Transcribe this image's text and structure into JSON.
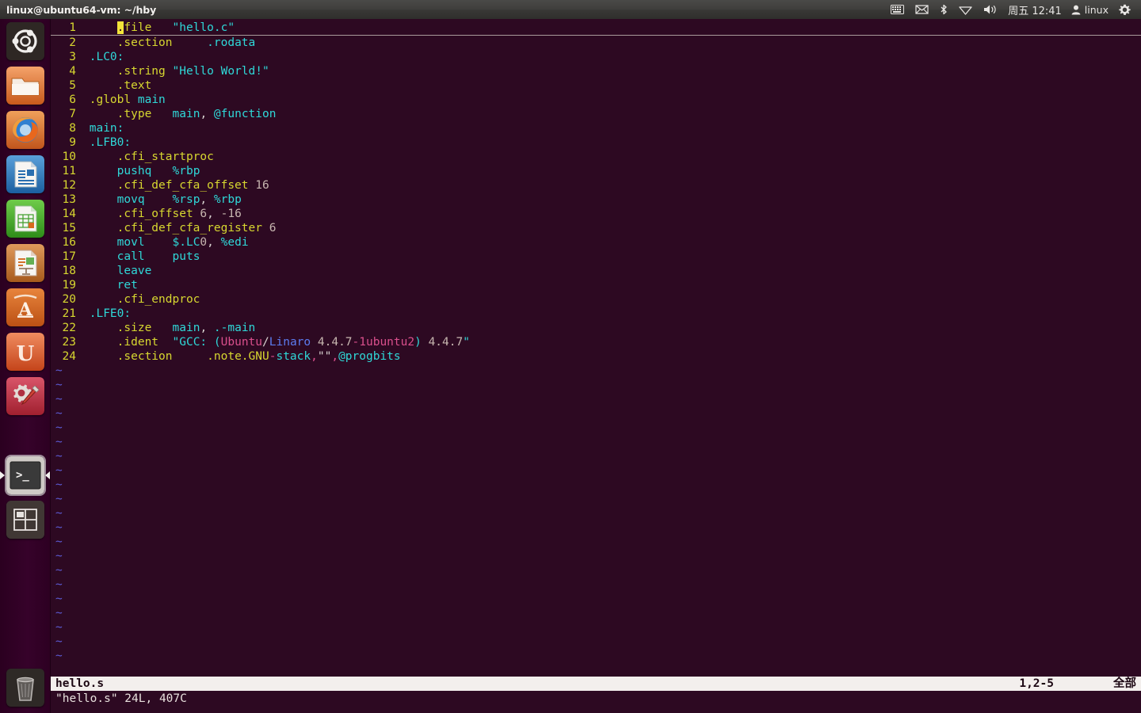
{
  "panel": {
    "title": "linux@ubuntu64-vm: ~/hby",
    "indicators": [
      {
        "name": "keyboard-indicator-icon",
        "glyph": "keyboard"
      },
      {
        "name": "mail-indicator-icon",
        "glyph": "mail"
      },
      {
        "name": "bluetooth-indicator-icon",
        "glyph": "bluetooth"
      },
      {
        "name": "network-indicator-icon",
        "glyph": "wifi"
      },
      {
        "name": "volume-indicator-icon",
        "glyph": "volume"
      }
    ],
    "clock": "周五 12:41",
    "user": "linux",
    "session_icon": "gear-icon"
  },
  "launcher": {
    "items": [
      {
        "name": "dash-home",
        "label": "Ubuntu Dash",
        "icon": "ubuntu-logo-icon"
      },
      {
        "name": "files",
        "label": "Files",
        "icon": "folder-icon"
      },
      {
        "name": "firefox",
        "label": "Firefox Web Browser",
        "icon": "firefox-icon"
      },
      {
        "name": "libreoffice-writer",
        "label": "LibreOffice Writer",
        "icon": "document-icon"
      },
      {
        "name": "libreoffice-calc",
        "label": "LibreOffice Calc",
        "icon": "spreadsheet-icon"
      },
      {
        "name": "libreoffice-impress",
        "label": "LibreOffice Impress",
        "icon": "presentation-icon"
      },
      {
        "name": "software-center",
        "label": "Ubuntu Software Center",
        "icon": "letter-a-icon"
      },
      {
        "name": "ubuntu-one",
        "label": "Ubuntu One",
        "icon": "letter-u-icon"
      },
      {
        "name": "system-settings",
        "label": "System Settings",
        "icon": "gear-wrench-icon"
      },
      {
        "name": "terminal",
        "label": "Terminal",
        "icon": "terminal-icon",
        "active": true
      },
      {
        "name": "workspace-switcher",
        "label": "Workspace Switcher",
        "icon": "workspace-grid-icon"
      }
    ],
    "trash": {
      "name": "trash",
      "label": "Trash",
      "icon": "trash-icon"
    }
  },
  "editor": {
    "cursor_char": ".",
    "lines": [
      {
        "n": "1",
        "cursorline": true,
        "cursor": true,
        "tokens": [
          {
            "t": "     ",
            "c": "c-white"
          },
          {
            "t": ".file",
            "c": "c-directive",
            "cursor_first": true
          },
          {
            "t": "   ",
            "c": "c-white"
          },
          {
            "t": "\"hello.c\"",
            "c": "c-string"
          }
        ]
      },
      {
        "n": "2",
        "tokens": [
          {
            "t": "     ",
            "c": "c-white"
          },
          {
            "t": ".section",
            "c": "c-directive"
          },
          {
            "t": "     ",
            "c": "c-white"
          },
          {
            "t": ".rodata",
            "c": "c-ident"
          }
        ]
      },
      {
        "n": "3",
        "tokens": [
          {
            "t": " ",
            "c": "c-white"
          },
          {
            "t": ".LC0:",
            "c": "c-ident"
          }
        ]
      },
      {
        "n": "4",
        "tokens": [
          {
            "t": "     ",
            "c": "c-white"
          },
          {
            "t": ".string",
            "c": "c-directive"
          },
          {
            "t": " ",
            "c": "c-white"
          },
          {
            "t": "\"Hello World!\"",
            "c": "c-string"
          }
        ]
      },
      {
        "n": "5",
        "tokens": [
          {
            "t": "     ",
            "c": "c-white"
          },
          {
            "t": ".text",
            "c": "c-directive"
          }
        ]
      },
      {
        "n": "6",
        "tokens": [
          {
            "t": " ",
            "c": "c-white"
          },
          {
            "t": ".globl",
            "c": "c-directive"
          },
          {
            "t": " ",
            "c": "c-white"
          },
          {
            "t": "main",
            "c": "c-ident"
          }
        ]
      },
      {
        "n": "7",
        "tokens": [
          {
            "t": "     ",
            "c": "c-white"
          },
          {
            "t": ".type",
            "c": "c-directive"
          },
          {
            "t": "   ",
            "c": "c-white"
          },
          {
            "t": "main",
            "c": "c-ident"
          },
          {
            "t": ",",
            "c": "c-white"
          },
          {
            "t": " @function",
            "c": "c-ident"
          }
        ]
      },
      {
        "n": "8",
        "tokens": [
          {
            "t": " ",
            "c": "c-white"
          },
          {
            "t": "main:",
            "c": "c-ident"
          }
        ]
      },
      {
        "n": "9",
        "tokens": [
          {
            "t": " ",
            "c": "c-white"
          },
          {
            "t": ".LFB0:",
            "c": "c-ident"
          }
        ]
      },
      {
        "n": "10",
        "tokens": [
          {
            "t": "     ",
            "c": "c-white"
          },
          {
            "t": ".cfi_startproc",
            "c": "c-directive"
          }
        ]
      },
      {
        "n": "11",
        "tokens": [
          {
            "t": "     ",
            "c": "c-white"
          },
          {
            "t": "pushq",
            "c": "c-ident"
          },
          {
            "t": "   ",
            "c": "c-white"
          },
          {
            "t": "%rbp",
            "c": "c-ident"
          }
        ]
      },
      {
        "n": "12",
        "tokens": [
          {
            "t": "     ",
            "c": "c-white"
          },
          {
            "t": ".cfi_def_cfa_offset",
            "c": "c-directive"
          },
          {
            "t": " ",
            "c": "c-white"
          },
          {
            "t": "16",
            "c": "c-number"
          }
        ]
      },
      {
        "n": "13",
        "tokens": [
          {
            "t": "     ",
            "c": "c-white"
          },
          {
            "t": "movq",
            "c": "c-ident"
          },
          {
            "t": "    ",
            "c": "c-white"
          },
          {
            "t": "%rsp",
            "c": "c-ident"
          },
          {
            "t": ", ",
            "c": "c-white"
          },
          {
            "t": "%rbp",
            "c": "c-ident"
          }
        ]
      },
      {
        "n": "14",
        "tokens": [
          {
            "t": "     ",
            "c": "c-white"
          },
          {
            "t": ".cfi_offset",
            "c": "c-directive"
          },
          {
            "t": " ",
            "c": "c-white"
          },
          {
            "t": "6",
            "c": "c-number"
          },
          {
            "t": ", ",
            "c": "c-white"
          },
          {
            "t": "-16",
            "c": "c-number"
          }
        ]
      },
      {
        "n": "15",
        "tokens": [
          {
            "t": "     ",
            "c": "c-white"
          },
          {
            "t": ".cfi_def_cfa_register",
            "c": "c-directive"
          },
          {
            "t": " ",
            "c": "c-white"
          },
          {
            "t": "6",
            "c": "c-number"
          }
        ]
      },
      {
        "n": "16",
        "tokens": [
          {
            "t": "     ",
            "c": "c-white"
          },
          {
            "t": "movl",
            "c": "c-ident"
          },
          {
            "t": "    ",
            "c": "c-white"
          },
          {
            "t": "$.LC",
            "c": "c-ident"
          },
          {
            "t": "0",
            "c": "c-number"
          },
          {
            "t": ", ",
            "c": "c-white"
          },
          {
            "t": "%edi",
            "c": "c-ident"
          }
        ]
      },
      {
        "n": "17",
        "tokens": [
          {
            "t": "     ",
            "c": "c-white"
          },
          {
            "t": "call",
            "c": "c-ident"
          },
          {
            "t": "    ",
            "c": "c-white"
          },
          {
            "t": "puts",
            "c": "c-ident"
          }
        ]
      },
      {
        "n": "18",
        "tokens": [
          {
            "t": "     ",
            "c": "c-white"
          },
          {
            "t": "leave",
            "c": "c-ident"
          }
        ]
      },
      {
        "n": "19",
        "tokens": [
          {
            "t": "     ",
            "c": "c-white"
          },
          {
            "t": "ret",
            "c": "c-ident"
          }
        ]
      },
      {
        "n": "20",
        "tokens": [
          {
            "t": "     ",
            "c": "c-white"
          },
          {
            "t": ".cfi_endproc",
            "c": "c-directive"
          }
        ]
      },
      {
        "n": "21",
        "tokens": [
          {
            "t": " ",
            "c": "c-white"
          },
          {
            "t": ".LFE0:",
            "c": "c-ident"
          }
        ]
      },
      {
        "n": "22",
        "tokens": [
          {
            "t": "     ",
            "c": "c-white"
          },
          {
            "t": ".size",
            "c": "c-directive"
          },
          {
            "t": "   ",
            "c": "c-white"
          },
          {
            "t": "main",
            "c": "c-ident"
          },
          {
            "t": ", ",
            "c": "c-white"
          },
          {
            "t": ".-main",
            "c": "c-ident"
          }
        ]
      },
      {
        "n": "23",
        "tokens": [
          {
            "t": "     ",
            "c": "c-white"
          },
          {
            "t": ".ident",
            "c": "c-directive"
          },
          {
            "t": "  ",
            "c": "c-white"
          },
          {
            "t": "\"GCC: (",
            "c": "c-string"
          },
          {
            "t": "Ubuntu",
            "c": "c-magenta"
          },
          {
            "t": "/",
            "c": "c-white"
          },
          {
            "t": "Linaro",
            "c": "c-blue"
          },
          {
            "t": " ",
            "c": "c-white"
          },
          {
            "t": "4.4.7",
            "c": "c-number"
          },
          {
            "t": "-",
            "c": "c-magenta"
          },
          {
            "t": "1ubuntu2",
            "c": "c-magenta"
          },
          {
            "t": ")",
            "c": "c-string"
          },
          {
            "t": " ",
            "c": "c-white"
          },
          {
            "t": "4.4.7",
            "c": "c-number"
          },
          {
            "t": "\"",
            "c": "c-string"
          }
        ]
      },
      {
        "n": "24",
        "tokens": [
          {
            "t": "     ",
            "c": "c-white"
          },
          {
            "t": ".section",
            "c": "c-directive"
          },
          {
            "t": "     ",
            "c": "c-white"
          },
          {
            "t": ".note.GNU",
            "c": "c-directive"
          },
          {
            "t": "-",
            "c": "c-magenta"
          },
          {
            "t": "stack",
            "c": "c-ident"
          },
          {
            "t": ",",
            "c": "c-magenta"
          },
          {
            "t": "\"\"",
            "c": "c-white"
          },
          {
            "t": ",",
            "c": "c-magenta"
          },
          {
            "t": "@progbits",
            "c": "c-ident"
          }
        ]
      }
    ],
    "tilde_rows": 21,
    "tilde_char": "~"
  },
  "status": {
    "filename": "hello.s",
    "position": "1,2-5",
    "scroll": "全部",
    "message": "\"hello.s\" 24L, 407C"
  }
}
